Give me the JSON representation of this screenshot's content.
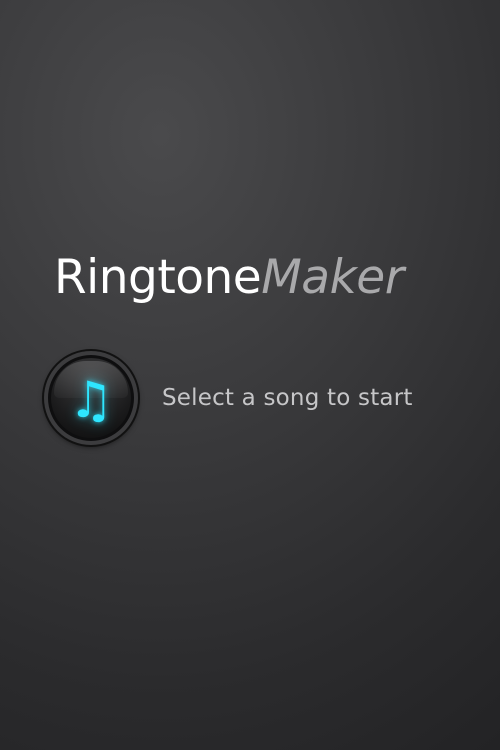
{
  "app": {
    "logo_part1": "Ringtone",
    "logo_part2": "Maker"
  },
  "song_picker": {
    "icon": "music-note-icon",
    "icon_glyph": "♫",
    "label": "Select a song to start"
  },
  "colors": {
    "accent": "#2ee6ff",
    "logo_primary": "#ffffff",
    "logo_secondary": "#a9a9ab",
    "prompt_text": "#c6c6c8",
    "background": "#333335"
  }
}
